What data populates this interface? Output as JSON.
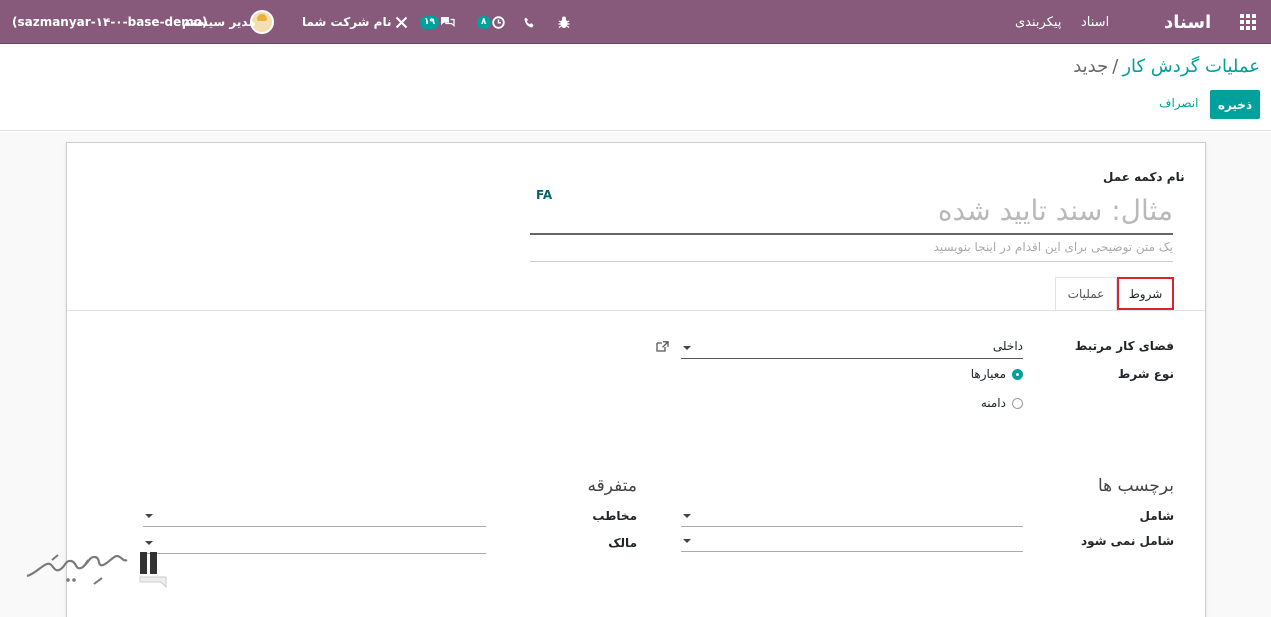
{
  "navbar": {
    "brand": "اسناد",
    "menu_items": [
      "اسناد",
      "پیکربندی"
    ],
    "icons": [
      "apps-icon",
      "bug-icon",
      "phone-icon",
      "activity-icon",
      "chat-icon",
      "tools-icon"
    ],
    "activity_count": "۸",
    "message_count": "۱۹",
    "company": "نام شرکت شما",
    "user": "مدیر سیستم",
    "database": "(sazmanyar-۱۴-۰-base-demo)",
    "color": "#875a7b"
  },
  "breadcrumb": {
    "parent": "عملیات گردش کار",
    "separator": "/",
    "current": "جدید"
  },
  "buttons": {
    "save": "ذخیره",
    "discard": "انصراف",
    "accent": "#00a09d"
  },
  "form": {
    "name_label": "نام دکمه عمل",
    "lang": "FA",
    "name_placeholder": "مثال: سند تایید شده",
    "desc_placeholder": "یک متن توضیحی برای این اقدام در اینجا بنویسید",
    "tabs": [
      {
        "label": "شروط",
        "active": true
      },
      {
        "label": "عملیات",
        "active": false
      }
    ],
    "workspace_label": "فضای کار مرتبط",
    "workspace_value": "داخلی",
    "condition_label": "نوع شرط",
    "condition_options": [
      {
        "label": "معیارها",
        "selected": true
      },
      {
        "label": "دامنه",
        "selected": false
      }
    ],
    "tags_section": "برچسب ها",
    "include_label": "شامل",
    "exclude_label": "شامل نمی شود",
    "misc_section": "متفرقه",
    "contact_label": "مخاطب",
    "owner_label": "مالک"
  },
  "watermark": "سپهرگستر"
}
